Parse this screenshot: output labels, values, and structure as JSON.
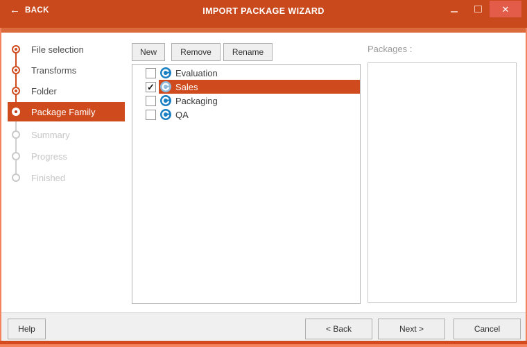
{
  "window": {
    "back_label": "BACK",
    "title": "IMPORT PACKAGE WIZARD"
  },
  "steps": [
    {
      "label": "File selection",
      "state": "done"
    },
    {
      "label": "Transforms",
      "state": "done"
    },
    {
      "label": "Folder",
      "state": "done"
    },
    {
      "label": "Package Family",
      "state": "active"
    },
    {
      "label": "Summary",
      "state": "pending"
    },
    {
      "label": "Progress",
      "state": "pending"
    },
    {
      "label": "Finished",
      "state": "pending"
    }
  ],
  "toolbar": {
    "new_label": "New",
    "remove_label": "Remove",
    "rename_label": "Rename"
  },
  "family_list": [
    {
      "label": "Evaluation",
      "checked": false,
      "selected": false
    },
    {
      "label": "Sales",
      "checked": true,
      "selected": true
    },
    {
      "label": "Packaging",
      "checked": false,
      "selected": false
    },
    {
      "label": "QA",
      "checked": false,
      "selected": false
    }
  ],
  "right_panel": {
    "label": "Packages :"
  },
  "footer": {
    "help_label": "Help",
    "back_label": "< Back",
    "next_label": "Next >",
    "cancel_label": "Cancel"
  },
  "icons": {
    "check_glyph": "✓",
    "close_glyph": "✕",
    "back_arrow_glyph": "←",
    "package_icon": "swirl-package-icon"
  },
  "colors": {
    "titlebar": "#C9481C",
    "accent_selection": "#CF4A1D",
    "close_button": "#E25C49",
    "icon_blue": "#1B7FC4",
    "icon_blue_selected": "#8FB9DA"
  }
}
